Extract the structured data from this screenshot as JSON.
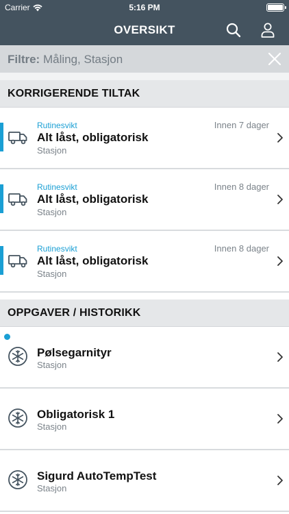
{
  "status_bar": {
    "carrier": "Carrier",
    "time": "5:16 PM"
  },
  "nav": {
    "title": "OVERSIKT",
    "search_icon": "search-icon",
    "profile_icon": "user-icon"
  },
  "filter": {
    "label": "Filtre:",
    "value": "Måling, Stasjon",
    "close_icon": "close-icon"
  },
  "sections": {
    "corrective": {
      "title": "KORRIGERENDE TILTAK",
      "items": [
        {
          "category": "Rutinesvikt",
          "due": "Innen 7 dager",
          "title": "Alt låst, obligatorisk",
          "subtitle": "Stasjon",
          "icon": "truck-icon"
        },
        {
          "category": "Rutinesvikt",
          "due": "Innen 8 dager",
          "title": "Alt låst, obligatorisk",
          "subtitle": "Stasjon",
          "icon": "truck-icon"
        },
        {
          "category": "Rutinesvikt",
          "due": "Innen 8 dager",
          "title": "Alt låst, obligatorisk",
          "subtitle": "Stasjon",
          "icon": "truck-icon"
        }
      ]
    },
    "tasks": {
      "title": "OPPGAVER / HISTORIKK",
      "items": [
        {
          "title": "Pølsegarnityr",
          "subtitle": "Stasjon",
          "icon": "snowflake-icon",
          "unread": true
        },
        {
          "title": "Obligatorisk 1",
          "subtitle": "Stasjon",
          "icon": "snowflake-icon",
          "unread": false
        },
        {
          "title": "Sigurd AutoTempTest",
          "subtitle": "Stasjon",
          "icon": "snowflake-icon",
          "unread": false
        }
      ]
    }
  },
  "colors": {
    "header_bg": "#44535f",
    "accent": "#1a9fd4",
    "filter_bg": "#d5d8db",
    "section_bg": "#e5e7e9"
  }
}
